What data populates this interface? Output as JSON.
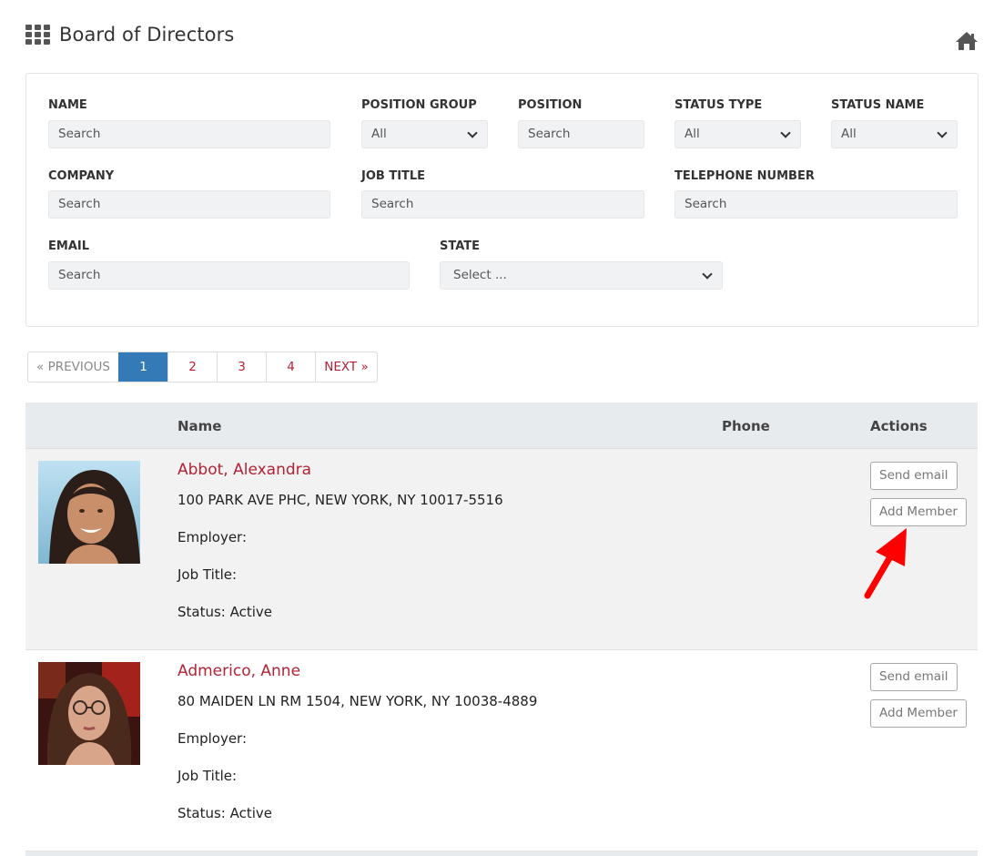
{
  "header": {
    "title": "Board of Directors",
    "grid_icon": "grid-icon",
    "home_icon": "home-icon"
  },
  "filters": {
    "name": {
      "label": "NAME",
      "placeholder": "Search"
    },
    "position_group": {
      "label": "POSITION GROUP",
      "value": "All"
    },
    "position": {
      "label": "POSITION",
      "placeholder": "Search"
    },
    "status_type": {
      "label": "STATUS TYPE",
      "value": "All"
    },
    "status_name": {
      "label": "STATUS NAME",
      "value": "All"
    },
    "company": {
      "label": "COMPANY",
      "placeholder": "Search"
    },
    "job_title": {
      "label": "JOB TITLE",
      "placeholder": "Search"
    },
    "telephone": {
      "label": "TELEPHONE NUMBER",
      "placeholder": "Search"
    },
    "email": {
      "label": "EMAIL",
      "placeholder": "Search"
    },
    "state": {
      "label": "STATE",
      "value": "Select ..."
    }
  },
  "pager": {
    "previous": "« PREVIOUS",
    "pages": [
      "1",
      "2",
      "3",
      "4"
    ],
    "active_page": "1",
    "next": "NEXT »"
  },
  "table": {
    "columns": {
      "name": "Name",
      "phone": "Phone",
      "actions": "Actions"
    },
    "rows": [
      {
        "name": "Abbot, Alexandra",
        "address": "100 PARK AVE PHC, NEW YORK, NY 10017-5516",
        "employer": "Employer:",
        "job_title": "Job Title:",
        "status": "Status: Active",
        "send_email": "Send email",
        "add_member": "Add Member"
      },
      {
        "name": "Admerico, Anne",
        "address": "80 MAIDEN LN RM 1504, NEW YORK, NY 10038-4889",
        "employer": "Employer:",
        "job_title": "Job Title:",
        "status": "Status: Active",
        "send_email": "Send email",
        "add_member": "Add Member"
      }
    ]
  },
  "colors": {
    "accent": "#b22234",
    "active_page": "#337ab7",
    "annotation_arrow": "#ff0000"
  }
}
